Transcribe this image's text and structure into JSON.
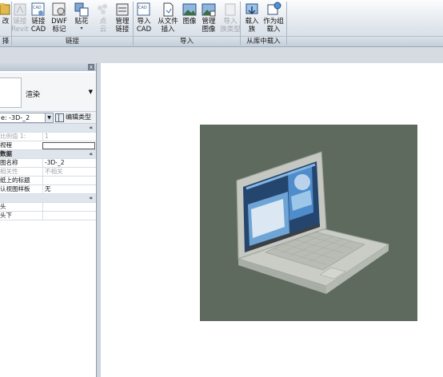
{
  "ribbon": {
    "buttons": [
      {
        "id": "partial",
        "label": "改",
        "disabled": false
      },
      {
        "id": "link-revit",
        "label1": "链接",
        "label2": "Revit",
        "disabled": true
      },
      {
        "id": "link-cad",
        "label1": "链接",
        "label2": "CAD",
        "disabled": false
      },
      {
        "id": "dwf",
        "label1": "DWF",
        "label2": "标记",
        "disabled": false
      },
      {
        "id": "decal",
        "label1": "贴花",
        "label2": "",
        "disabled": false
      },
      {
        "id": "pointcloud",
        "label1": "点",
        "label2": "云",
        "disabled": true
      },
      {
        "id": "manage-links",
        "label1": "管理",
        "label2": "链接",
        "disabled": false
      },
      {
        "id": "import-cad",
        "label1": "导入",
        "label2": "CAD",
        "disabled": false
      },
      {
        "id": "from-file",
        "label1": "从文件",
        "label2": "插入",
        "disabled": false
      },
      {
        "id": "image",
        "label1": "图像",
        "label2": "",
        "disabled": false
      },
      {
        "id": "manage-images",
        "label1": "管理",
        "label2": "图像",
        "disabled": false
      },
      {
        "id": "import-family-type",
        "label1": "导入",
        "label2": "族类型",
        "disabled": true
      },
      {
        "id": "load-family",
        "label1": "载入",
        "label2": "族",
        "disabled": false
      },
      {
        "id": "load-as-group",
        "label1": "作为组",
        "label2": "载入",
        "disabled": false
      }
    ],
    "groups": {
      "first": "择",
      "link": "链接",
      "import": "导入",
      "load": "从库中载入"
    }
  },
  "panel": {
    "close": "x",
    "preview_label": "渲染",
    "type_selector": "e: -3D-_2",
    "edit_type": "编辑类型",
    "rows": [
      {
        "k": "",
        "v": "",
        "cat": true,
        "collapse": "«"
      },
      {
        "k": "比例值 1:",
        "v": "1",
        "gray": true
      },
      {
        "k": "视程",
        "v": "",
        "input": true
      },
      {
        "k": "数据",
        "v": "",
        "cat": true,
        "collapse": "«"
      },
      {
        "k": "图名称",
        "v": "-3D-_2"
      },
      {
        "k": "相关性",
        "v": "不相关",
        "gray": true
      },
      {
        "k": "纸上的标题",
        "v": ""
      },
      {
        "k": "认视图样板",
        "v": "无"
      },
      {
        "k": "",
        "v": "",
        "cat": true,
        "collapse": "«"
      },
      {
        "k": "头",
        "v": ""
      },
      {
        "k": "头下",
        "v": ""
      }
    ]
  },
  "colors": {
    "ribbon_bg": "#dfe5ec",
    "view_bg": "#5f6a5f",
    "laptop_body": "#c9cdc6"
  }
}
